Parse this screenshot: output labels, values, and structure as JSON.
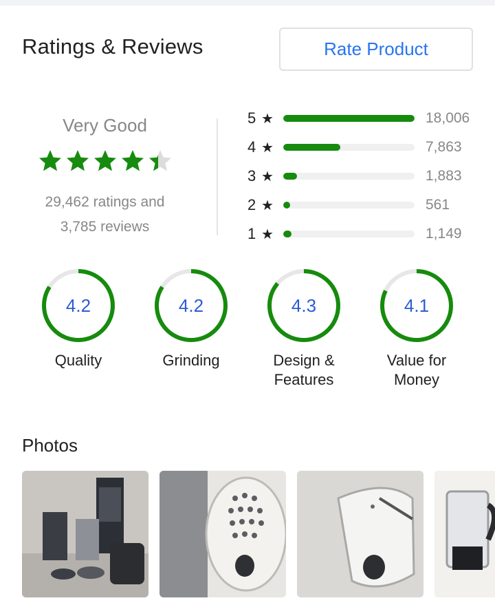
{
  "header": {
    "title": "Ratings & Reviews",
    "rate_button": "Rate Product"
  },
  "summary": {
    "label": "Very Good",
    "rating": 4.4,
    "stars_total": 5,
    "ratings_text": "29,462 ratings and",
    "reviews_text": "3,785 reviews"
  },
  "distribution": [
    {
      "stars": "5",
      "count": "18,006",
      "fraction": 1.0
    },
    {
      "stars": "4",
      "count": "7,863",
      "fraction": 0.437
    },
    {
      "stars": "3",
      "count": "1,883",
      "fraction": 0.105
    },
    {
      "stars": "2",
      "count": "561",
      "fraction": 0.031
    },
    {
      "stars": "1",
      "count": "1,149",
      "fraction": 0.064
    }
  ],
  "aspects": [
    {
      "value": "4.2",
      "label_line1": "Quality",
      "label_line2": ""
    },
    {
      "value": "4.2",
      "label_line1": "Grinding",
      "label_line2": ""
    },
    {
      "value": "4.3",
      "label_line1": "Design &",
      "label_line2": "Features"
    },
    {
      "value": "4.1",
      "label_line1": "Value for",
      "label_line2": "Money"
    }
  ],
  "photos": {
    "title": "Photos",
    "items": [
      "mixer-grinder-set-photo",
      "grater-disc-photo",
      "slicer-disc-photo",
      "blender-jar-photo"
    ]
  },
  "colors": {
    "accent_green": "#168b0d",
    "link_blue": "#2874f0",
    "gauge_text_blue": "#2c5bd4",
    "muted_gray": "#878787"
  }
}
